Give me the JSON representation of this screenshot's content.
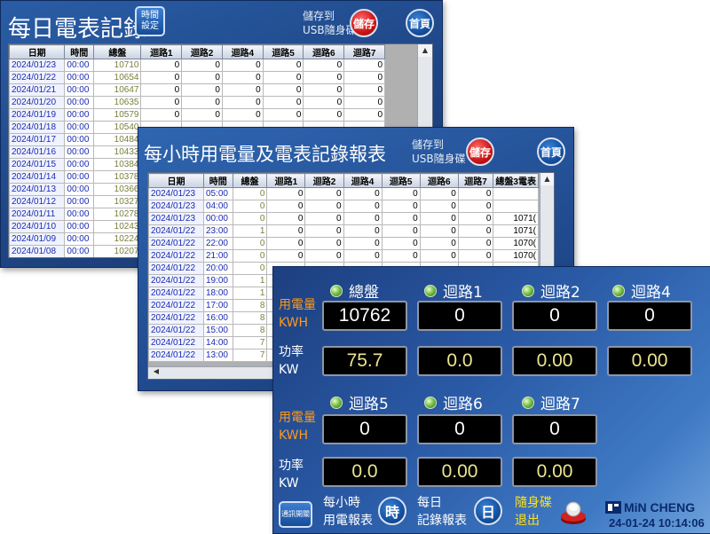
{
  "daily_panel": {
    "title": "每日電表記錄",
    "time_setting_button": [
      "時間",
      "設定"
    ],
    "save_usb_label": [
      "儲存到",
      "USB隨身碟"
    ],
    "save_button": "儲存",
    "home_button": "首頁",
    "columns": [
      "日期",
      "時間",
      "總盤",
      "迴路1",
      "迴路2",
      "迴路4",
      "迴路5",
      "迴路6",
      "迴路7"
    ],
    "rows": [
      [
        "2024/01/23",
        "00:00",
        "10710",
        "0",
        "0",
        "0",
        "0",
        "0",
        "0"
      ],
      [
        "2024/01/22",
        "00:00",
        "10654",
        "0",
        "0",
        "0",
        "0",
        "0",
        "0"
      ],
      [
        "2024/01/21",
        "00:00",
        "10647",
        "0",
        "0",
        "0",
        "0",
        "0",
        "0"
      ],
      [
        "2024/01/20",
        "00:00",
        "10635",
        "0",
        "0",
        "0",
        "0",
        "0",
        "0"
      ],
      [
        "2024/01/19",
        "00:00",
        "10579",
        "0",
        "0",
        "0",
        "0",
        "0",
        "0"
      ],
      [
        "2024/01/18",
        "00:00",
        "10540",
        "",
        "",
        "",
        "",
        "",
        ""
      ],
      [
        "2024/01/17",
        "00:00",
        "10484",
        "",
        "",
        "",
        "",
        "",
        ""
      ],
      [
        "2024/01/16",
        "00:00",
        "10433",
        "",
        "",
        "",
        "",
        "",
        ""
      ],
      [
        "2024/01/15",
        "00:00",
        "10384",
        "",
        "",
        "",
        "",
        "",
        ""
      ],
      [
        "2024/01/14",
        "00:00",
        "10378",
        "",
        "",
        "",
        "",
        "",
        ""
      ],
      [
        "2024/01/13",
        "00:00",
        "10366",
        "",
        "",
        "",
        "",
        "",
        ""
      ],
      [
        "2024/01/12",
        "00:00",
        "10327",
        "",
        "",
        "",
        "",
        "",
        ""
      ],
      [
        "2024/01/11",
        "00:00",
        "10278",
        "",
        "",
        "",
        "",
        "",
        ""
      ],
      [
        "2024/01/10",
        "00:00",
        "10243",
        "",
        "",
        "",
        "",
        "",
        ""
      ],
      [
        "2024/01/09",
        "00:00",
        "10224",
        "",
        "",
        "",
        "",
        "",
        ""
      ],
      [
        "2024/01/08",
        "00:00",
        "10207",
        "",
        "",
        "",
        "",
        "",
        ""
      ]
    ]
  },
  "hourly_panel": {
    "title": "每小時用電量及電表記錄報表",
    "save_usb_label": [
      "儲存到",
      "USB隨身碟"
    ],
    "save_button": "儲存",
    "home_button": "首頁",
    "columns": [
      "日期",
      "時間",
      "總盤",
      "迴路1",
      "迴路2",
      "迴路4",
      "迴路5",
      "迴路6",
      "迴路7",
      "總盤3電表"
    ],
    "rows": [
      [
        "2024/01/23",
        "05:00",
        "0",
        "0",
        "0",
        "0",
        "0",
        "0",
        "0",
        ""
      ],
      [
        "2024/01/23",
        "04:00",
        "0",
        "0",
        "0",
        "0",
        "0",
        "0",
        "0",
        ""
      ],
      [
        "2024/01/23",
        "00:00",
        "0",
        "0",
        "0",
        "0",
        "0",
        "0",
        "0",
        "1071("
      ],
      [
        "2024/01/22",
        "23:00",
        "1",
        "0",
        "0",
        "0",
        "0",
        "0",
        "0",
        "1071("
      ],
      [
        "2024/01/22",
        "22:00",
        "0",
        "0",
        "0",
        "0",
        "0",
        "0",
        "0",
        "1070("
      ],
      [
        "2024/01/22",
        "21:00",
        "0",
        "0",
        "0",
        "0",
        "0",
        "0",
        "0",
        "1070("
      ],
      [
        "2024/01/22",
        "20:00",
        "0",
        "",
        "",
        "",
        "",
        "",
        "",
        ""
      ],
      [
        "2024/01/22",
        "19:00",
        "1",
        "",
        "",
        "",
        "",
        "",
        "",
        ""
      ],
      [
        "2024/01/22",
        "18:00",
        "1",
        "",
        "",
        "",
        "",
        "",
        "",
        ""
      ],
      [
        "2024/01/22",
        "17:00",
        "8",
        "",
        "",
        "",
        "",
        "",
        "",
        ""
      ],
      [
        "2024/01/22",
        "16:00",
        "8",
        "",
        "",
        "",
        "",
        "",
        "",
        ""
      ],
      [
        "2024/01/22",
        "15:00",
        "8",
        "",
        "",
        "",
        "",
        "",
        "",
        ""
      ],
      [
        "2024/01/22",
        "14:00",
        "7",
        "",
        "",
        "",
        "",
        "",
        "",
        ""
      ],
      [
        "2024/01/22",
        "13:00",
        "7",
        "",
        "",
        "",
        "",
        "",
        "",
        ""
      ]
    ]
  },
  "meter_panel": {
    "energy_label": [
      "用電量",
      "KWH"
    ],
    "power_label": [
      "功率",
      "KW"
    ],
    "row1_channels": [
      "總盤",
      "迴路1",
      "迴路2",
      "迴路4"
    ],
    "row1_kwh": [
      "10762",
      "0",
      "0",
      "0"
    ],
    "row1_kw": [
      "75.7",
      "0.0",
      "0.00",
      "0.00"
    ],
    "row2_channels": [
      "迴路5",
      "迴路6",
      "迴路7"
    ],
    "row2_kwh": [
      "0",
      "0",
      "0"
    ],
    "row2_kw": [
      "0.0",
      "0.00",
      "0.00"
    ],
    "comm_button": "通訊開關",
    "hourly_report_label": [
      "每小時",
      "用電報表"
    ],
    "hourly_button": "時",
    "daily_report_label": [
      "每日",
      "記錄報表"
    ],
    "daily_button": "日",
    "usb_eject_label": [
      "隨身碟",
      "退出"
    ],
    "brand": "MiN CHENG",
    "datetime": "24-01-24 10:14:06"
  }
}
